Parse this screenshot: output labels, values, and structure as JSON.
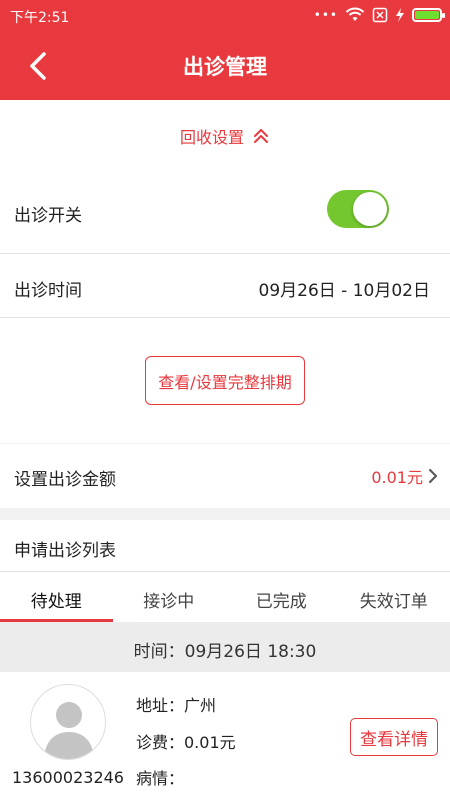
{
  "status_bar": {
    "time": "下午2:51",
    "icons": [
      "dots-icon",
      "wifi-icon",
      "sim-icon",
      "charging-icon",
      "battery-icon"
    ]
  },
  "nav": {
    "title": "出诊管理",
    "back_icon": "chevron-left-icon"
  },
  "collapse": {
    "label": "回收设置",
    "icon": "double-chevron-up-icon"
  },
  "visit_switch": {
    "label": "出诊开关",
    "on": true
  },
  "visit_time": {
    "label": "出诊时间",
    "value": "09月26日 - 10月02日"
  },
  "schedule_button": {
    "label": "查看/设置完整排期"
  },
  "amount": {
    "label": "设置出诊金额",
    "value": "0.01元"
  },
  "list_header": {
    "label": "申请出诊列表"
  },
  "tabs": [
    {
      "label": "待处理",
      "active": true
    },
    {
      "label": "接诊中",
      "active": false
    },
    {
      "label": "已完成",
      "active": false
    },
    {
      "label": "失效订单",
      "active": false
    }
  ],
  "order": {
    "time": "时间：09月26日 18:30",
    "phone": "13600023246",
    "address": "地址：广州",
    "fee": "诊费：0.01元",
    "condition": "病情：",
    "detail_button": "查看详情"
  },
  "colors": {
    "brand": "#e8393e",
    "toggle_on": "#74c72f",
    "battery": "#6ede31"
  }
}
